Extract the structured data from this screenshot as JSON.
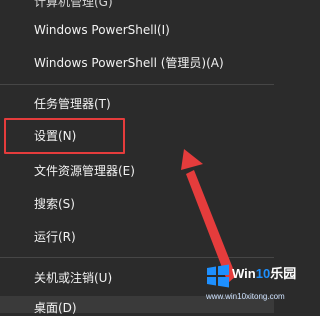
{
  "menu": {
    "items": [
      {
        "label": "计算机管理(G)"
      },
      {
        "label": "Windows PowerShell(I)"
      },
      {
        "label": "Windows PowerShell (管理员)(A)"
      },
      {
        "label": "任务管理器(T)"
      },
      {
        "label": "设置(N)"
      },
      {
        "label": "文件资源管理器(E)"
      },
      {
        "label": "搜索(S)"
      },
      {
        "label": "运行(R)"
      },
      {
        "label": "关机或注销(U)"
      },
      {
        "label": "桌面(D)"
      }
    ]
  },
  "watermark": {
    "title": "Win10乐园",
    "url": "www.win10xitong.com"
  },
  "annotation": {
    "color": "#e53c3c"
  }
}
